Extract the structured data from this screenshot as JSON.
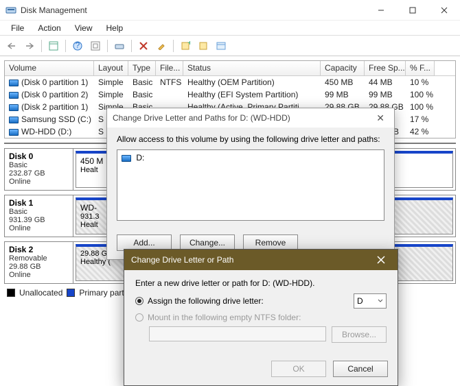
{
  "window": {
    "title": "Disk Management"
  },
  "menu": {
    "file": "File",
    "action": "Action",
    "view": "View",
    "help": "Help"
  },
  "columns": {
    "volume": "Volume",
    "layout": "Layout",
    "type": "Type",
    "fs": "File...",
    "status": "Status",
    "capacity": "Capacity",
    "free": "Free Sp...",
    "pfree": "% F..."
  },
  "rows": [
    {
      "volume": "(Disk 0 partition 1)",
      "layout": "Simple",
      "type": "Basic",
      "fs": "NTFS",
      "status": "Healthy (OEM Partition)",
      "capacity": "450 MB",
      "free": "44 MB",
      "pfree": "10 %"
    },
    {
      "volume": "(Disk 0 partition 2)",
      "layout": "Simple",
      "type": "Basic",
      "fs": "",
      "status": "Healthy (EFI System Partition)",
      "capacity": "99 MB",
      "free": "99 MB",
      "pfree": "100 %"
    },
    {
      "volume": "(Disk 2 partition 1)",
      "layout": "Simple",
      "type": "Basic",
      "fs": "",
      "status": "Healthy (Active, Primary Partiti...",
      "capacity": "29.88 GB",
      "free": "29.88 GB",
      "pfree": "100 %"
    },
    {
      "volume": "Samsung SSD (C:)",
      "layout": "S",
      "type": "",
      "fs": "",
      "status": "",
      "capacity": "",
      "free": ".74 GB",
      "pfree": "17 %"
    },
    {
      "volume": "WD-HDD (D:)",
      "layout": "S",
      "type": "",
      "fs": "",
      "status": "",
      "capacity": "",
      "free": "7.53 GB",
      "pfree": "42 %"
    }
  ],
  "disks": [
    {
      "name": "Disk 0",
      "type": "Basic",
      "size": "232.87 GB",
      "state": "Online",
      "parts": [
        {
          "label": "450 M",
          "line2": "Healt"
        },
        {
          "label": "",
          "line2": "mp, Primary"
        }
      ]
    },
    {
      "name": "Disk 1",
      "type": "Basic",
      "size": "931.39 GB",
      "state": "Online",
      "parts": [
        {
          "label": "WD-",
          "line2": "931.3",
          "line3": "Healt"
        }
      ],
      "hatch": true
    },
    {
      "name": "Disk 2",
      "type": "Removable",
      "size": "29.88 GB",
      "state": "Online",
      "parts": [
        {
          "label": "",
          "line2": "29.88 G",
          "line3": "Healthy ("
        }
      ],
      "hatch": true
    }
  ],
  "legend": {
    "unalloc": "Unallocated",
    "primary": "Primary partit",
    "color_unalloc": "#000000",
    "color_primary": "#1745c9"
  },
  "dlg1": {
    "title": "Change Drive Letter and Paths for D: (WD-HDD)",
    "instruction": "Allow access to this volume by using the following drive letter and paths:",
    "entry": "D:",
    "add": "Add...",
    "change": "Change...",
    "remove": "Remove"
  },
  "dlg2": {
    "title": "Change Drive Letter or Path",
    "prompt": "Enter a new drive letter or path for D: (WD-HDD).",
    "opt_assign": "Assign the following drive letter:",
    "opt_mount": "Mount in the following empty NTFS folder:",
    "selected_letter": "D",
    "browse": "Browse...",
    "ok": "OK",
    "cancel": "Cancel"
  }
}
